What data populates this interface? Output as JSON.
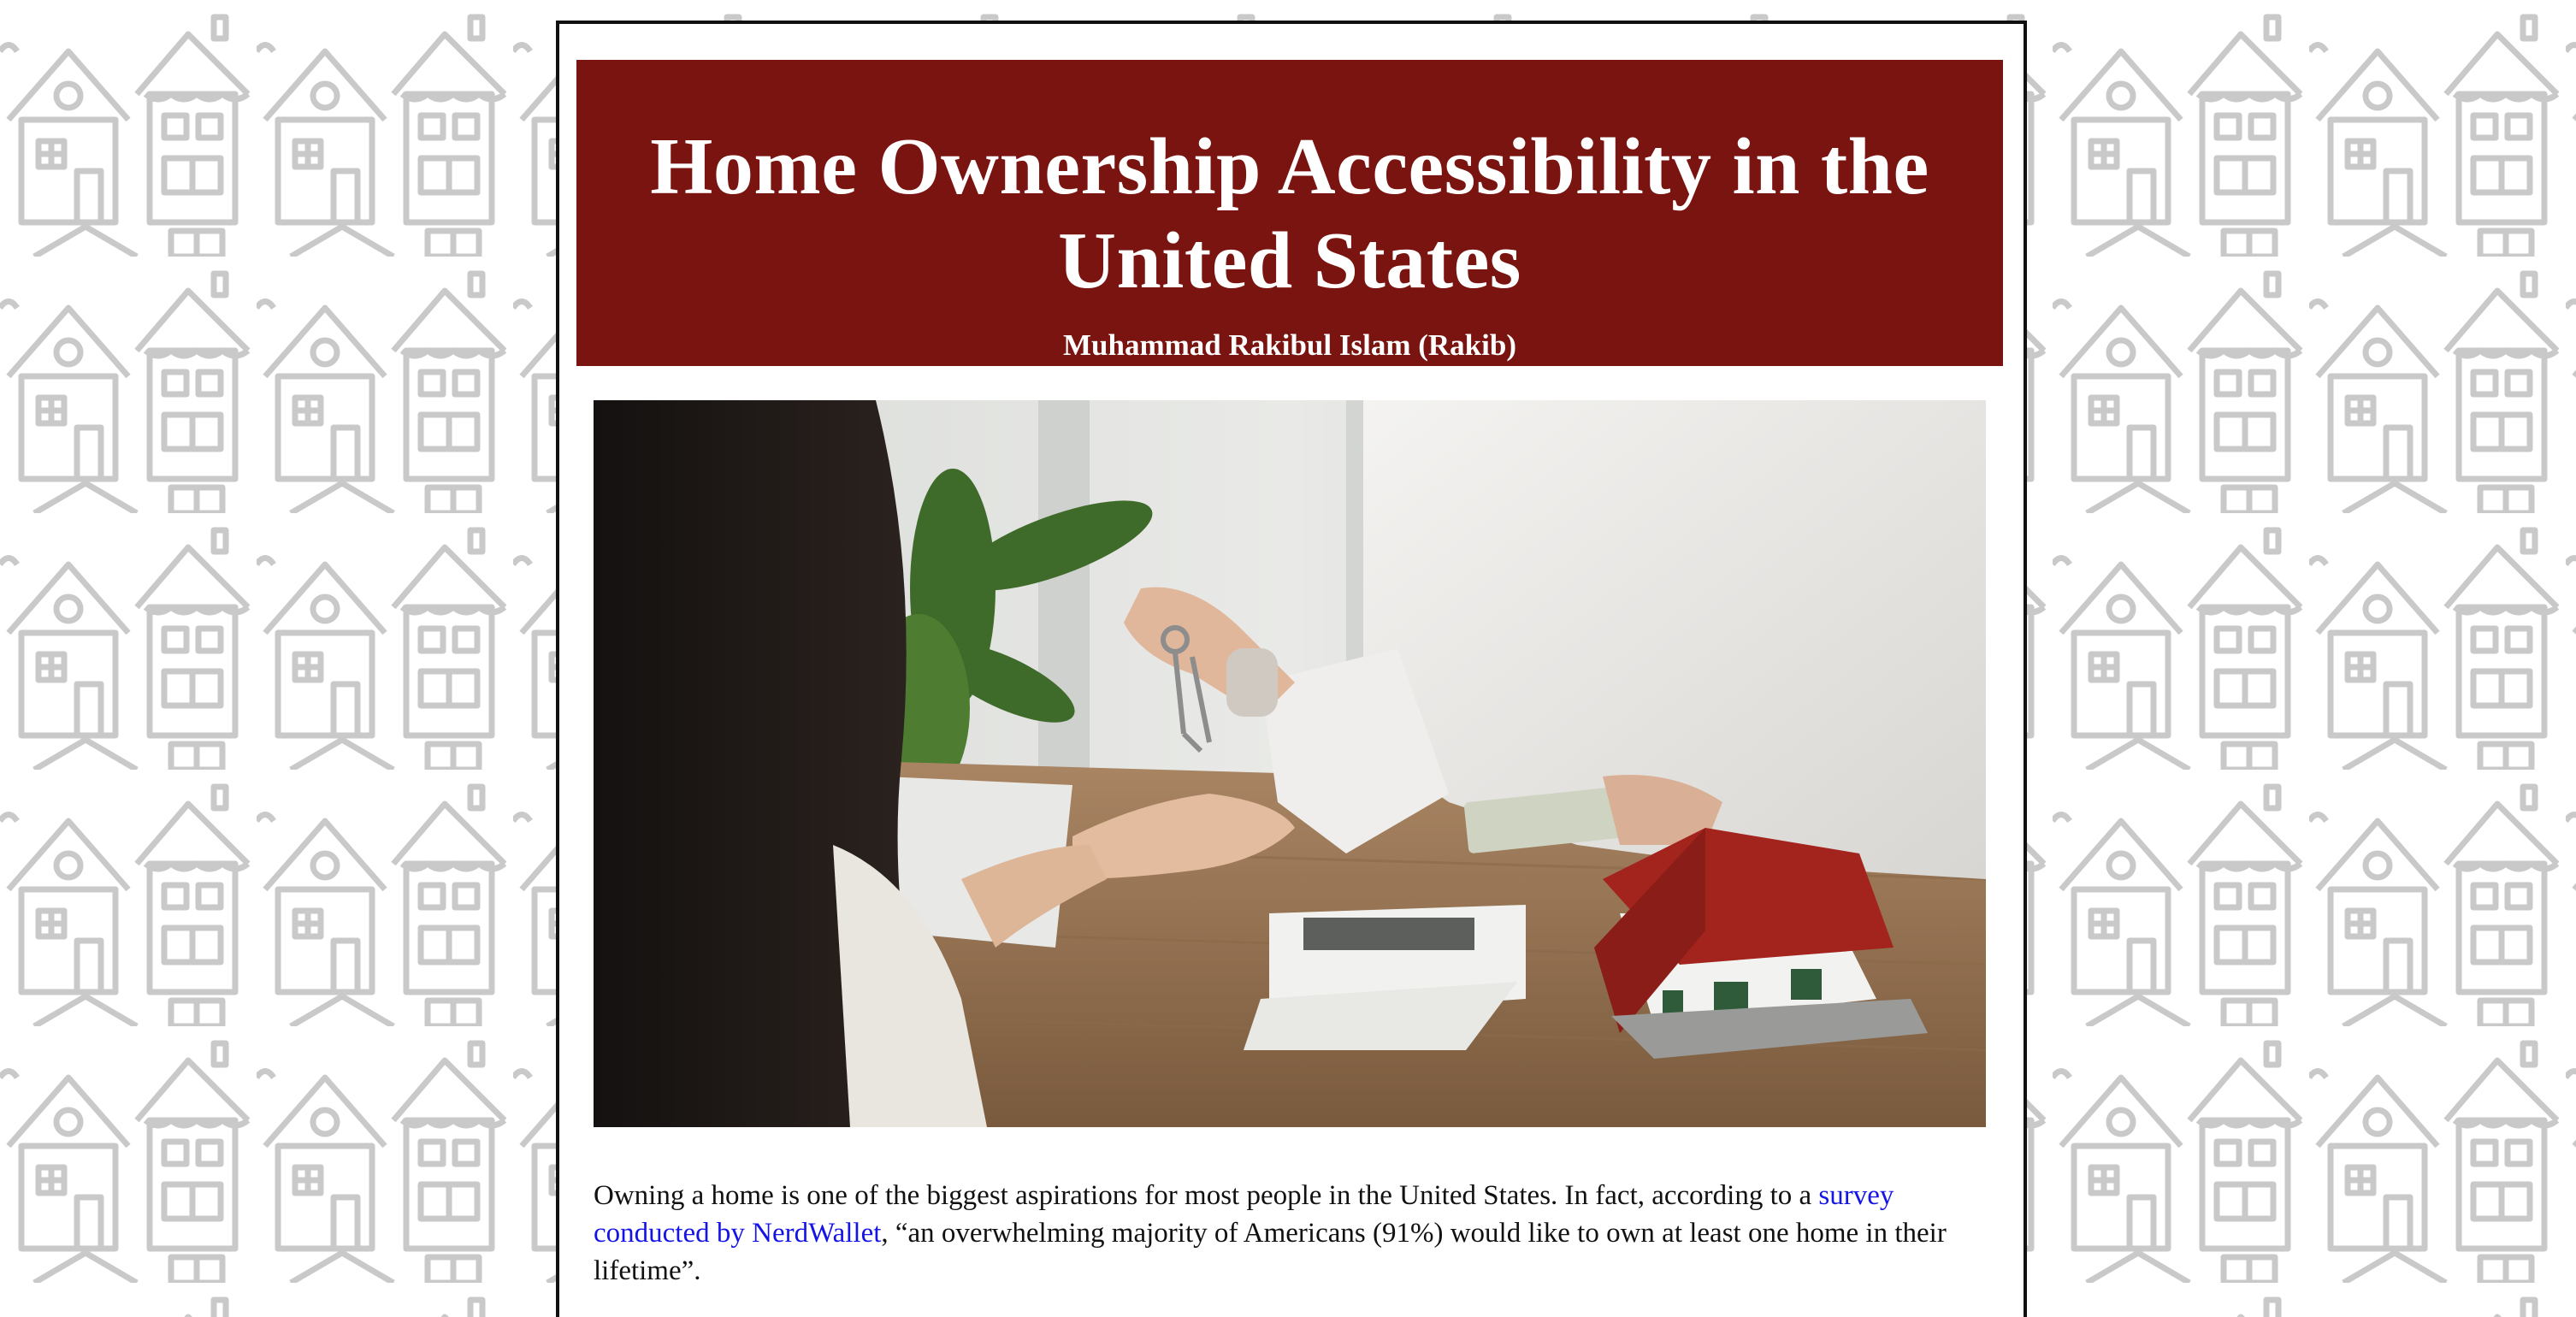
{
  "article": {
    "title": "Home Ownership Accessibility in the United States",
    "author": "Muhammad Rakibul Islam (Rakib)",
    "hero_image_icon": "house-keys-handover-photo-icon",
    "intro": {
      "text_before_link": "Owning a home is one of the biggest aspirations for most people in the United States. In fact, according to a ",
      "link_text": "survey conducted by NerdWallet",
      "text_after_link": ", “an overwhelming majority of Americans (91%) would like to own at least one home in their lifetime”."
    }
  },
  "theme": {
    "banner_color": "#7a1410",
    "link_color": "#1414e6",
    "background_pattern_icon": "house-pattern-icon"
  }
}
